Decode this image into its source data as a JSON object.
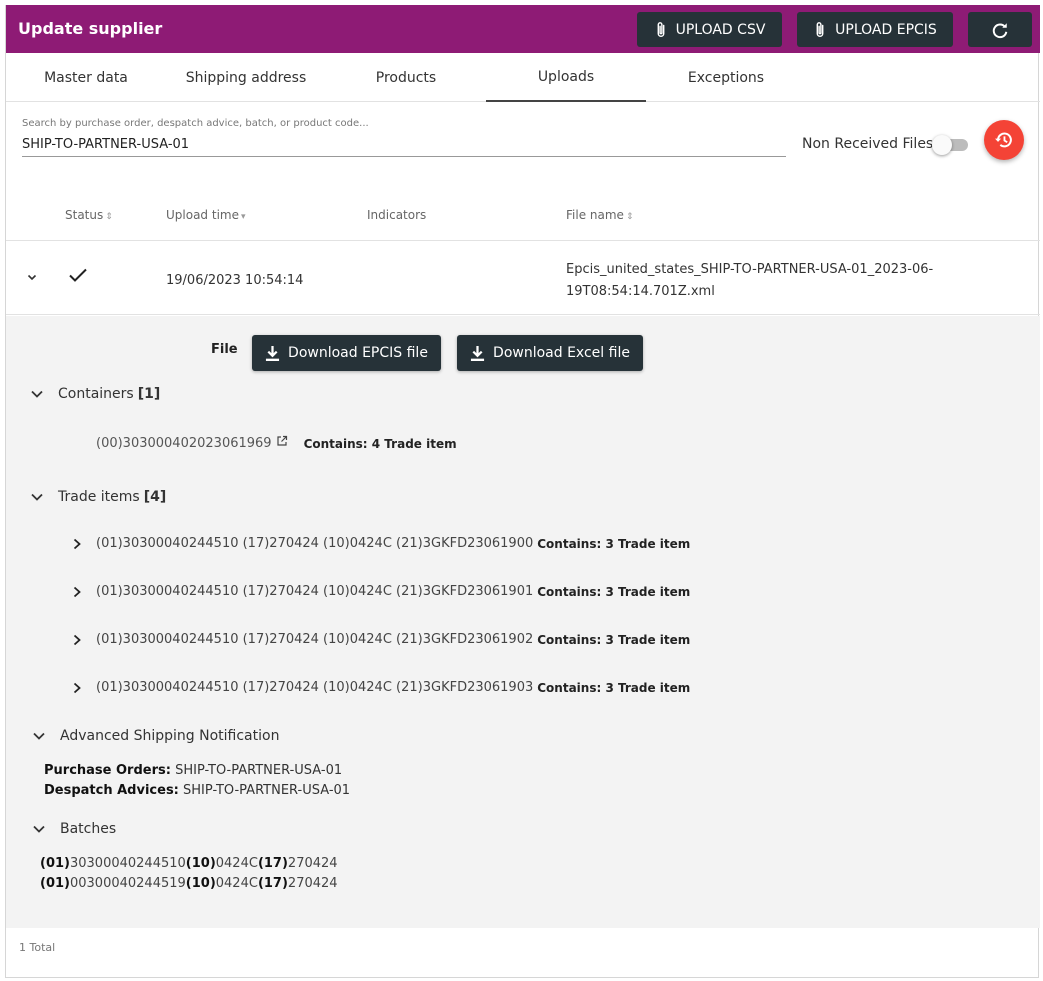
{
  "header": {
    "title": "Update supplier",
    "upload_csv": "UPLOAD CSV",
    "upload_epcis": "UPLOAD EPCIS",
    "refresh_icon": "refresh-icon"
  },
  "tabs": [
    {
      "label": "Master data"
    },
    {
      "label": "Shipping address"
    },
    {
      "label": "Products"
    },
    {
      "label": "Uploads",
      "active": true
    },
    {
      "label": "Exceptions"
    }
  ],
  "search": {
    "placeholder": "Search by purchase order, despatch advice, batch, or product code...",
    "value": "SHIP-TO-PARTNER-USA-01"
  },
  "filters": {
    "non_received_label": "Non Received Files",
    "non_received_on": false
  },
  "table": {
    "headers": {
      "status": "Status",
      "upload_time": "Upload time",
      "indicators": "Indicators",
      "file_name": "File name"
    },
    "rows": [
      {
        "status": "success",
        "upload_time": "19/06/2023 10:54:14",
        "file_name_line1": "Epcis_united_states_SHIP-TO-PARTNER-USA-01_2023-06-",
        "file_name_line2": "19T08:54:14.701Z.xml"
      }
    ]
  },
  "detail": {
    "file_label": "File",
    "download_epcis": "Download EPCIS file",
    "download_excel": "Download Excel file",
    "containers": {
      "label": "Containers",
      "count": "[1]",
      "items": [
        {
          "code": "(00)303000402023061969",
          "contains": "Contains: 4 Trade item"
        }
      ]
    },
    "trade_items": {
      "label": "Trade items",
      "count": "[4]",
      "items": [
        {
          "code": "(01)30300040244510 (17)270424 (10)0424C (21)3GKFD23061900",
          "contains": "Contains: 3 Trade item"
        },
        {
          "code": "(01)30300040244510 (17)270424 (10)0424C (21)3GKFD23061901",
          "contains": "Contains: 3 Trade item"
        },
        {
          "code": "(01)30300040244510 (17)270424 (10)0424C (21)3GKFD23061902",
          "contains": "Contains: 3 Trade item"
        },
        {
          "code": "(01)30300040244510 (17)270424 (10)0424C (21)3GKFD23061903",
          "contains": "Contains: 3 Trade item"
        }
      ]
    },
    "asn": {
      "label": "Advanced Shipping Notification",
      "purchase_orders_label": "Purchase Orders:",
      "purchase_orders_value": "SHIP-TO-PARTNER-USA-01",
      "despatch_advices_label": "Despatch Advices:",
      "despatch_advices_value": "SHIP-TO-PARTNER-USA-01"
    },
    "batches": {
      "label": "Batches",
      "items": [
        {
          "ai1": "(01)",
          "gtin": "30300040244510",
          "ai2": "(10)",
          "lot": "0424C",
          "ai3": "(17)",
          "exp": "270424"
        },
        {
          "ai1": "(01)",
          "gtin": "00300040244519",
          "ai2": "(10)",
          "lot": "0424C",
          "ai3": "(17)",
          "exp": "270424"
        }
      ]
    }
  },
  "footer": {
    "total": "1 Total"
  },
  "colors": {
    "brand": "#8e1b75",
    "dark_button": "#263238",
    "fab": "#f44336"
  }
}
